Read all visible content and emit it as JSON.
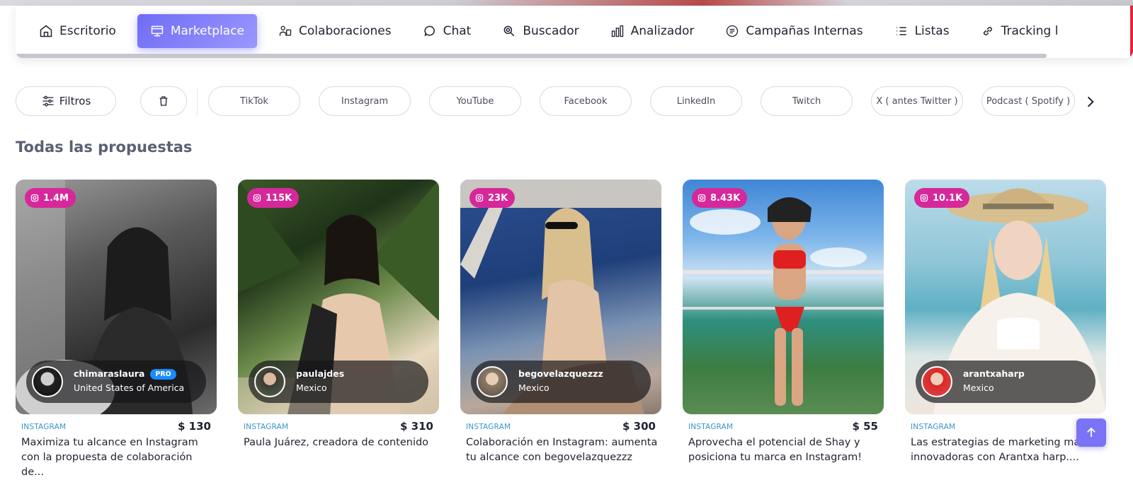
{
  "nav": {
    "items": [
      {
        "label": "Escritorio",
        "icon": "home-icon"
      },
      {
        "label": "Marketplace",
        "icon": "storefront-icon",
        "active": true
      },
      {
        "label": "Colaboraciones",
        "icon": "collaboration-icon"
      },
      {
        "label": "Chat",
        "icon": "chat-bubble-icon"
      },
      {
        "label": "Buscador",
        "icon": "search-icon"
      },
      {
        "label": "Analizador",
        "icon": "analytics-icon"
      },
      {
        "label": "Campañas Internas",
        "icon": "campaign-list-icon"
      },
      {
        "label": "Listas",
        "icon": "list-icon"
      },
      {
        "label": "Tracking l",
        "icon": "link-icon"
      }
    ],
    "accent": "#6f6cf5"
  },
  "filters": {
    "filter_label": "Filtros",
    "platforms": [
      "TikTok",
      "Instagram",
      "YouTube",
      "Facebook",
      "LinkedIn",
      "Twitch",
      "X ( antes Twitter )",
      "Podcast ( Spotify )"
    ]
  },
  "section_title": "Todas las propuestas",
  "cards": [
    {
      "followers": "1.4M",
      "name": "chimaraslaura",
      "pro": "PRO",
      "location": "United States of America",
      "platform": "INSTAGRAM",
      "price": "$ 130",
      "description": "Maximiza tu alcance en Instagram con la propuesta de colaboración de..."
    },
    {
      "followers": "115K",
      "name": "paulajdes",
      "location": "Mexico",
      "platform": "INSTAGRAM",
      "price": "$ 310",
      "description": "Paula Juárez, creadora de contenido"
    },
    {
      "followers": "23K",
      "name": "begovelazquezzz",
      "location": "Mexico",
      "platform": "INSTAGRAM",
      "price": "$ 300",
      "description": "Colaboración en Instagram: aumenta tu alcance con begovelazquezzz"
    },
    {
      "followers": "8.43K",
      "name": "",
      "location": "",
      "platform": "INSTAGRAM",
      "price": "$ 55",
      "description": "Aprovecha el potencial de Shay y posiciona tu marca en Instagram!"
    },
    {
      "followers": "10.1K",
      "name": "arantxaharp",
      "location": "Mexico",
      "platform": "INSTAGRAM",
      "price": "$",
      "description": "Las estrategias de marketing mas innovadoras con Arantxa harp...."
    }
  ],
  "colors": {
    "badge": "#d6289b",
    "pro": "#1a8cff",
    "platform": "#3a96c4",
    "scroll_top": "#7a73f5"
  }
}
